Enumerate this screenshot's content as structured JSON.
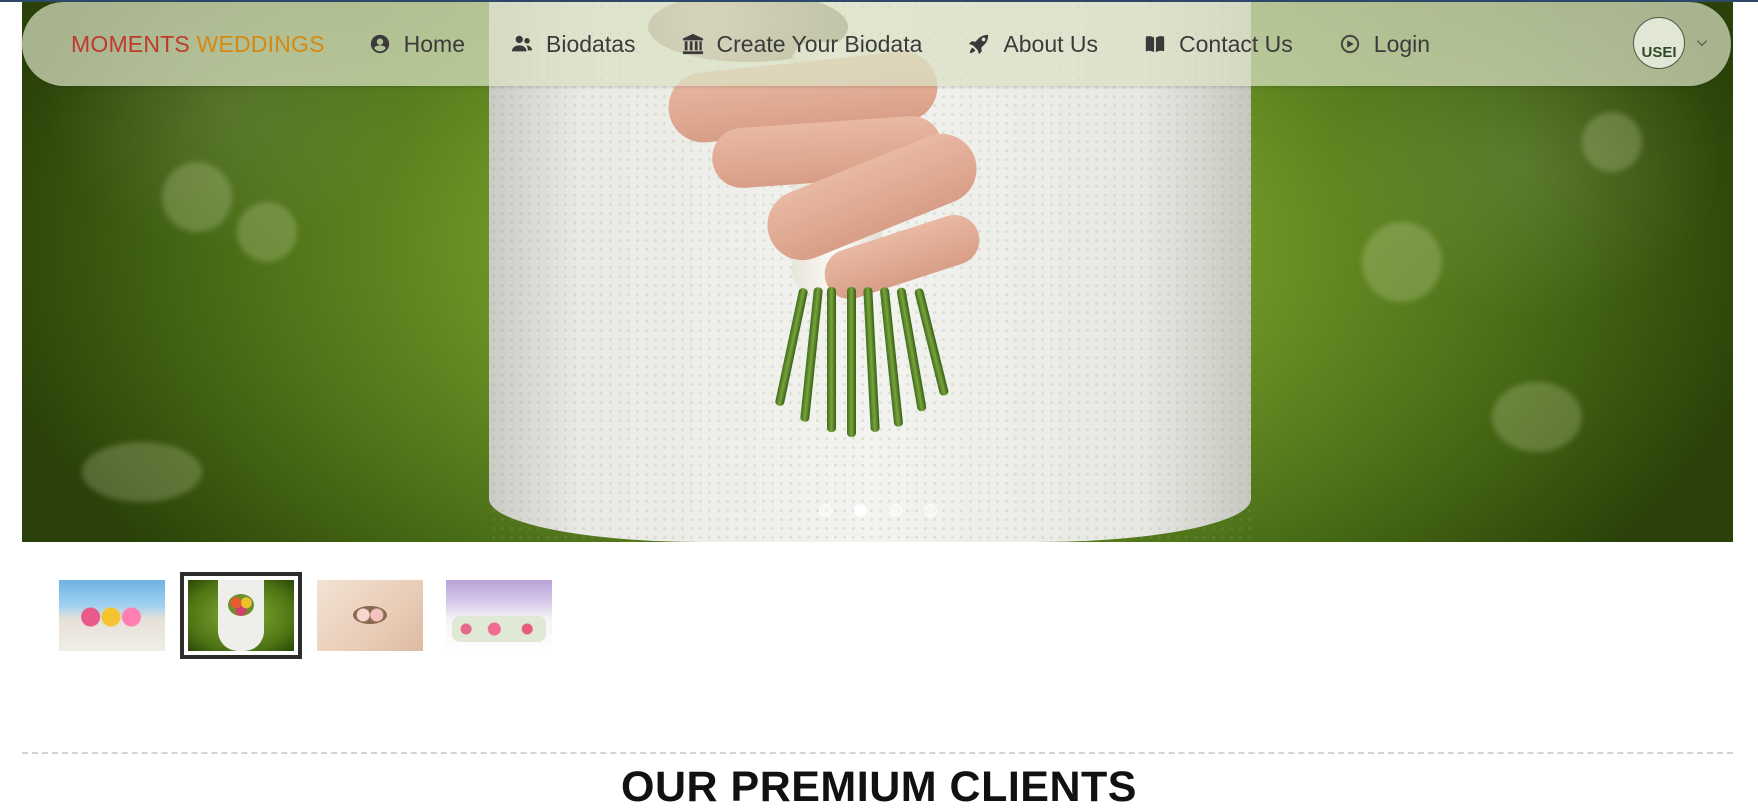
{
  "brand": {
    "part1": "MOMENTS",
    "part2": "WEDDINGS",
    "color1": "#c0392b",
    "color2": "#d68910"
  },
  "nav": {
    "items": [
      {
        "label": "Home",
        "icon": "user-circle-icon"
      },
      {
        "label": "Biodatas",
        "icon": "users-icon"
      },
      {
        "label": "Create Your Biodata",
        "icon": "bank-icon"
      },
      {
        "label": "About Us",
        "icon": "rocket-icon"
      },
      {
        "label": "Contact Us",
        "icon": "book-icon"
      },
      {
        "label": "Login",
        "icon": "login-icon"
      }
    ],
    "user": {
      "avatar_text": "USEI",
      "menu_icon": "chevron-down-icon"
    }
  },
  "carousel": {
    "slide_count": 4,
    "active_index": 1,
    "current_image": "bride-holding-bouquet",
    "thumbnails": [
      {
        "image": "beach-wedding-arch"
      },
      {
        "image": "bride-holding-bouquet"
      },
      {
        "image": "bride-hands-flowers"
      },
      {
        "image": "wedding-reception-table"
      }
    ]
  },
  "section": {
    "title": "OUR PREMIUM CLIENTS"
  }
}
